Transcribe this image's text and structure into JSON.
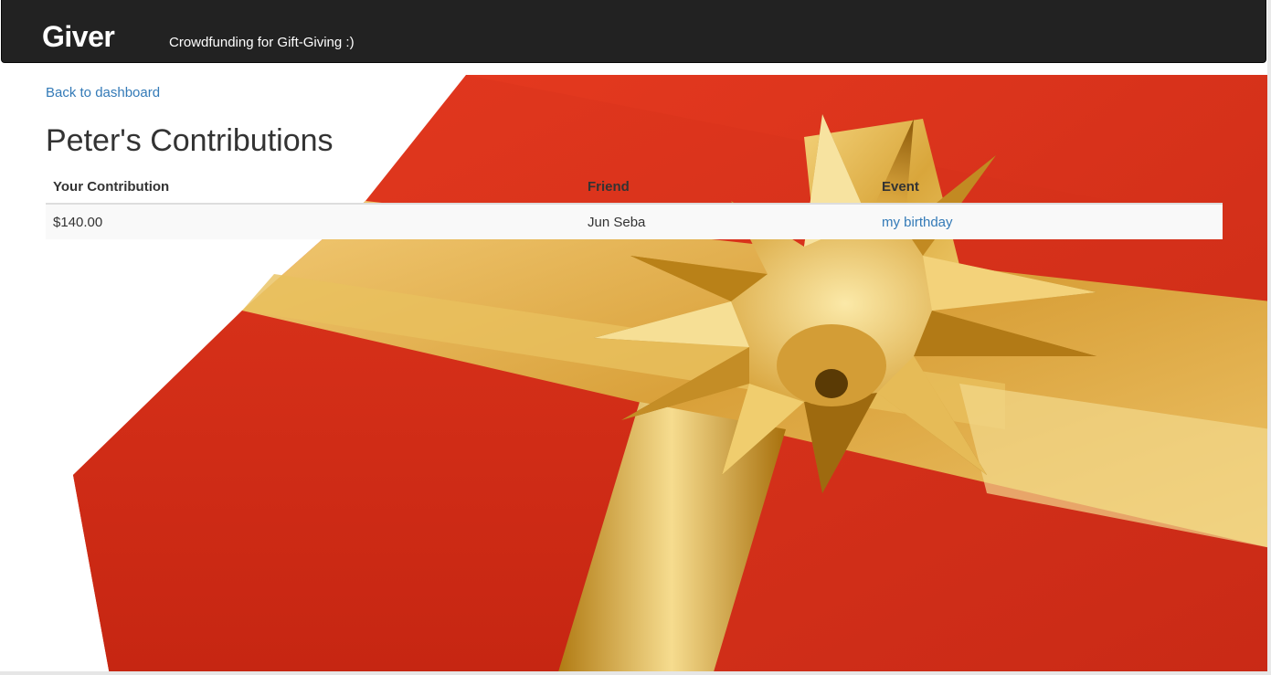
{
  "navbar": {
    "brand": "Giver",
    "tagline": "Crowdfunding for Gift-Giving :)"
  },
  "back_link": "Back to dashboard",
  "page_title": "Peter's Contributions",
  "table": {
    "headers": [
      "Your Contribution",
      "Friend",
      "Event"
    ],
    "rows": [
      {
        "contribution": "$140.00",
        "friend": "Jun Seba",
        "event": "my birthday"
      }
    ]
  },
  "colors": {
    "navbar_bg": "#222222",
    "link": "#337ab7",
    "gift_red": "#d9331c",
    "ribbon_gold": "#e2b347"
  },
  "background_image": "red-gift-box-with-gold-bow"
}
